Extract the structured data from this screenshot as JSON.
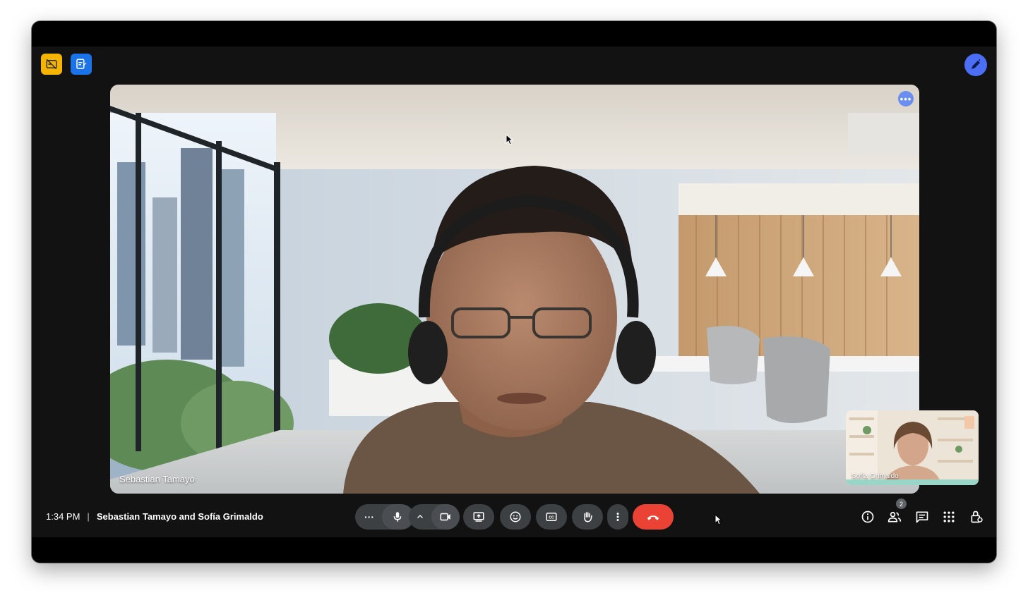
{
  "meeting": {
    "time": "1:34 PM",
    "separator": "|",
    "title": "Sebastian Tamayo and Sofía Grimaldo"
  },
  "main_tile": {
    "participant_name": "Sebastian Tamayo",
    "more_label": "•••"
  },
  "self_view": {
    "participant_name": "Sofía Grimaldo"
  },
  "controls": {
    "more_options_label": "···",
    "people_count": "2"
  },
  "icons": {
    "top_left_1": "captions-off-icon",
    "top_left_2": "notes-icon",
    "top_right": "pen-icon",
    "mic": "mic-icon",
    "chevron": "chevron-up-icon",
    "camera": "camera-icon",
    "present": "present-icon",
    "emoji": "emoji-icon",
    "captions": "captions-icon",
    "hand": "raise-hand-icon",
    "kebab": "more-vert-icon",
    "end": "end-call-icon",
    "info": "info-icon",
    "people": "people-icon",
    "chat": "chat-icon",
    "activities": "apps-icon",
    "host": "host-controls-icon"
  },
  "colors": {
    "end_call": "#ea4335",
    "accent_blue": "#1a73e8",
    "accent_yellow": "#f5b400",
    "control_bg": "#3c4043"
  }
}
